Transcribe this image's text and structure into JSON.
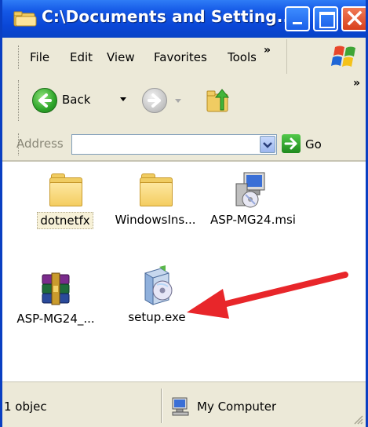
{
  "window": {
    "title": "C:\\Documents and Setting..."
  },
  "menu": {
    "items": [
      "File",
      "Edit",
      "View",
      "Favorites",
      "Tools"
    ],
    "overflow": "»"
  },
  "toolbar": {
    "back_label": "Back",
    "overflow": "»"
  },
  "address": {
    "label": "Address",
    "value": "",
    "go_label": "Go"
  },
  "files": [
    {
      "name": "dotnetfx",
      "icon": "folder-icon",
      "selected": true
    },
    {
      "name": "WindowsIns...",
      "icon": "folder-icon",
      "selected": false
    },
    {
      "name": "ASP-MG24.msi",
      "icon": "msi-installer-icon",
      "selected": false
    },
    {
      "name": "ASP-MG24_...",
      "icon": "winrar-archive-icon",
      "selected": false
    },
    {
      "name": "setup.exe",
      "icon": "setup-cd-icon",
      "selected": false
    }
  ],
  "status": {
    "count_text": "1 objec",
    "zone_text": "My Computer"
  },
  "annotation": {
    "arrow_color": "#e8262a",
    "points_to": "setup.exe"
  },
  "colors": {
    "titlebar": "#0a46d6",
    "chrome": "#ece9d8",
    "close_button": "#d8401c"
  }
}
